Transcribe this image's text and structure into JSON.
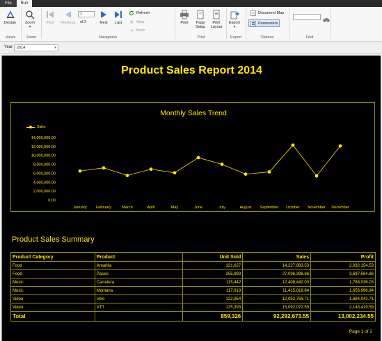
{
  "tabs": {
    "file": "File",
    "run": "Run"
  },
  "ribbon": {
    "views": {
      "design": "Design",
      "group": "Views"
    },
    "zoom": {
      "zoom": "Zoom",
      "group": "Zoom"
    },
    "navigation": {
      "first": "First",
      "previous": "Previous",
      "page_value": "1",
      "of_pages": "of 2",
      "next": "Next",
      "last": "Last",
      "refresh": "Refresh",
      "stop": "Stop",
      "back": "Back",
      "group": "Navigation"
    },
    "print": {
      "print": "Print",
      "page_setup": "Page Setup",
      "print_layout": "Print Layout",
      "group": "Print"
    },
    "export": {
      "export": "Export",
      "group": "Export"
    },
    "options": {
      "document_map": "Document Map",
      "parameters": "Parameters",
      "group": "Options"
    },
    "find": {
      "group": "Find",
      "placeholder": ""
    }
  },
  "parameters": {
    "year_label": "Year",
    "year_value": "2014"
  },
  "report": {
    "title": "Product Sales Report 2014",
    "summary_title": "Product Sales Summary",
    "pager": "Page 1 of 2",
    "table": {
      "headers": [
        "Product Category",
        "Product",
        "Unit Sold",
        "Sales",
        "Profit"
      ],
      "rows": [
        [
          "Food",
          "Amarilla",
          "121,627",
          "14,227,983.53",
          "2,032,154.53"
        ],
        [
          "Food",
          "Paseo",
          "255,993",
          "27,096,396.86",
          "3,697,584.86"
        ],
        [
          "Music",
          "Carretera",
          "115,442",
          "12,408,442.03",
          "1,788,036.03"
        ],
        [
          "Music",
          "Montana",
          "117,918",
          "11,415,018.84",
          "1,656,996.84"
        ],
        [
          "Video",
          "Velo",
          "122,954",
          "12,052,759.71",
          "1,684,042.71"
        ],
        [
          "Video",
          "VTT",
          "125,393",
          "15,092,072.59",
          "2,143,419.59"
        ]
      ],
      "total": [
        "Total",
        "",
        "859,326",
        "92,292,673.55",
        "13,002,234.55"
      ]
    }
  },
  "colors": {
    "report_bg": "#000000",
    "report_fg": "#ffe600",
    "border": "#8c8c00"
  },
  "chart_data": {
    "type": "line",
    "title": "Monthly Sales Trend",
    "series": [
      {
        "name": "Sales",
        "values": [
          6500000,
          7200000,
          5500000,
          6900000,
          6100000,
          9500000,
          8000000,
          5800000,
          6300000,
          12300000,
          5400000,
          12100000
        ]
      }
    ],
    "categories": [
      "January",
      "February",
      "March",
      "April",
      "May",
      "June",
      "July",
      "August",
      "September",
      "October",
      "November",
      "December"
    ],
    "y_ticks": [
      "14,000,000.00",
      "12,000,000.00",
      "10,000,000.00",
      "8,000,000.00",
      "6,000,000.00",
      "4,000,000.00",
      "2,000,000.00",
      "0.00"
    ],
    "ylim": [
      0,
      14000000
    ],
    "legend_position": "top-left",
    "grid": false
  }
}
